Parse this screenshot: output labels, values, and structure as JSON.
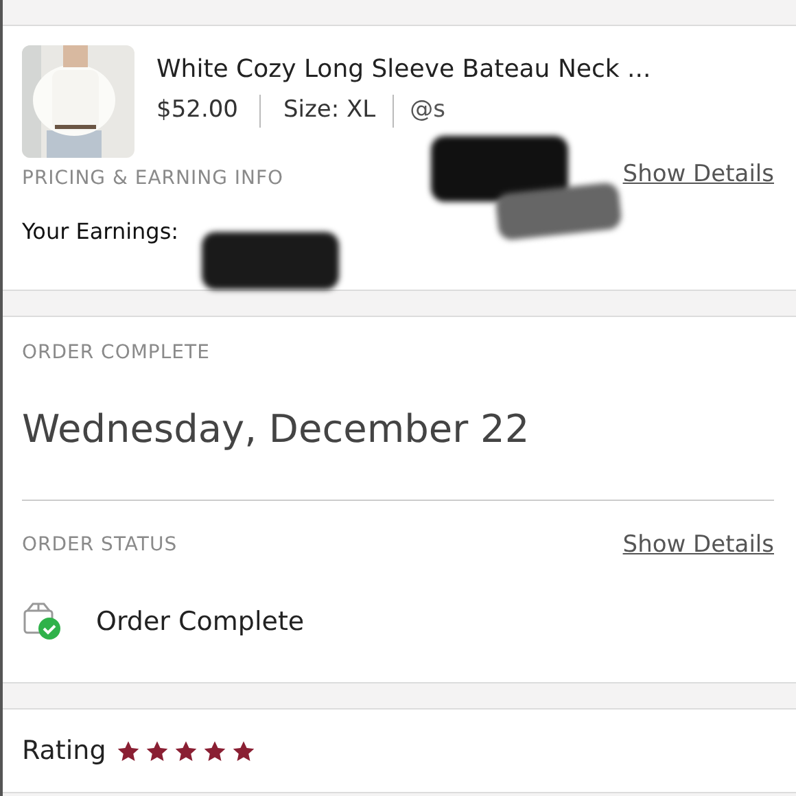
{
  "item": {
    "title": "White Cozy Long Sleeve Bateau Neck ...",
    "price": "$52.00",
    "size": "Size: XL",
    "seller": "@s"
  },
  "pricing": {
    "heading": "PRICING & EARNING INFO",
    "link": "Show Details",
    "earnings_label": "Your Earnings:"
  },
  "order": {
    "heading": "ORDER COMPLETE",
    "date": "Wednesday, December 22"
  },
  "status": {
    "heading": "ORDER STATUS",
    "link": "Show Details",
    "text": "Order Complete"
  },
  "rating": {
    "label": "Rating",
    "stars": 5
  }
}
